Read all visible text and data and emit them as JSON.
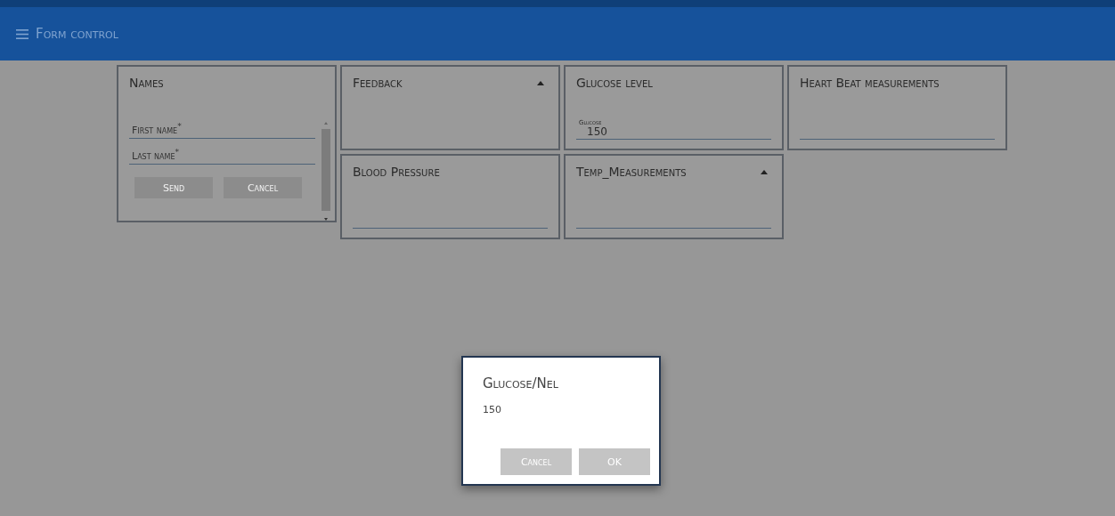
{
  "app_bar": {
    "title": "Form control"
  },
  "cards": [
    {
      "kind": "names",
      "title": "Names",
      "fields": [
        {
          "label": "First name$^{*}$"
        },
        {
          "label": "Last name$^{*}$"
        }
      ],
      "buttons": [
        {
          "label": "Send",
          "disabled": true
        },
        {
          "label": "Cancel",
          "disabled": true
        }
      ]
    },
    {
      "kind": "dropdown",
      "title": "Feedback"
    },
    {
      "kind": "input",
      "title": "Glucose level",
      "field": {
        "label": "Glucose",
        "value": "150"
      }
    },
    {
      "kind": "input",
      "title": "Heart Beat measurements"
    },
    {
      "kind": "input",
      "title": "Blood Pressure"
    },
    {
      "kind": "dropdown_input",
      "title": "Temp_Measurements"
    }
  ],
  "dialog": {
    "title": "Glucose/Nel",
    "value": "150",
    "buttons": [
      {
        "label": "Cancel"
      },
      {
        "label": "OK"
      }
    ]
  }
}
